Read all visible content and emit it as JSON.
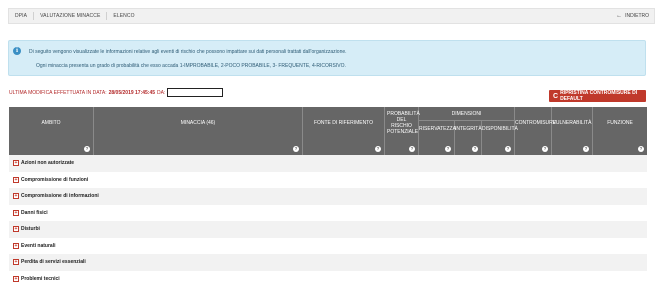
{
  "breadcrumb": {
    "items": [
      "DPIA",
      "VALUTAZIONE MINACCE",
      "ELENCO"
    ],
    "back_label": "INDIETRO",
    "back_arrow": "←"
  },
  "info": {
    "icon": "i",
    "line1": "Di seguito vengono visualizzate le informazioni relative agli eventi di rischio che possono impattare sui dati personali trattati dall'organizzazione.",
    "line2": "Ogni minaccia presenta un grado di probabilità che esso accada 1-IMPROBABILE, 2-POCO PROBABILE, 3- FREQUENTE, 4-RICORSIVO."
  },
  "last_modified": {
    "label": "ULTIMA MODIFICA EFFETTUATA IN DATA:",
    "date": "28/05/2019 17:45:45",
    "by": "DA:"
  },
  "reset_button": {
    "icon": "C",
    "label": "RIPRISTINA CONTROMISURE DI DEFAULT"
  },
  "table": {
    "headers": {
      "ambito": "AMBITO",
      "minaccia": "MINACCIA (46)",
      "fonte": "FONTE DI RIFERIMENTO",
      "probabilita": "PROBABILITÀ DEL RISCHIO POTENZIALE",
      "dimensioni": "DIMENSIONI",
      "riservatezza": "RISERVATEZZA",
      "integrita": "INTEGRITÀ",
      "disponibilita": "DISPONIBILITÀ",
      "contromisure": "CONTROMISURE",
      "vulnerabilita": "VULNERABILITÀ",
      "funzione": "FUNZIONE"
    },
    "help_glyph": "?",
    "expand_glyph": "+",
    "groups": [
      "Azioni non autorizzate",
      "Compromissione di funzioni",
      "Compromissione di informazioni",
      "Danni fisici",
      "Disturbi",
      "Eventi naturali",
      "Perdita di servizi essenziali",
      "Problemi tecnici"
    ]
  }
}
